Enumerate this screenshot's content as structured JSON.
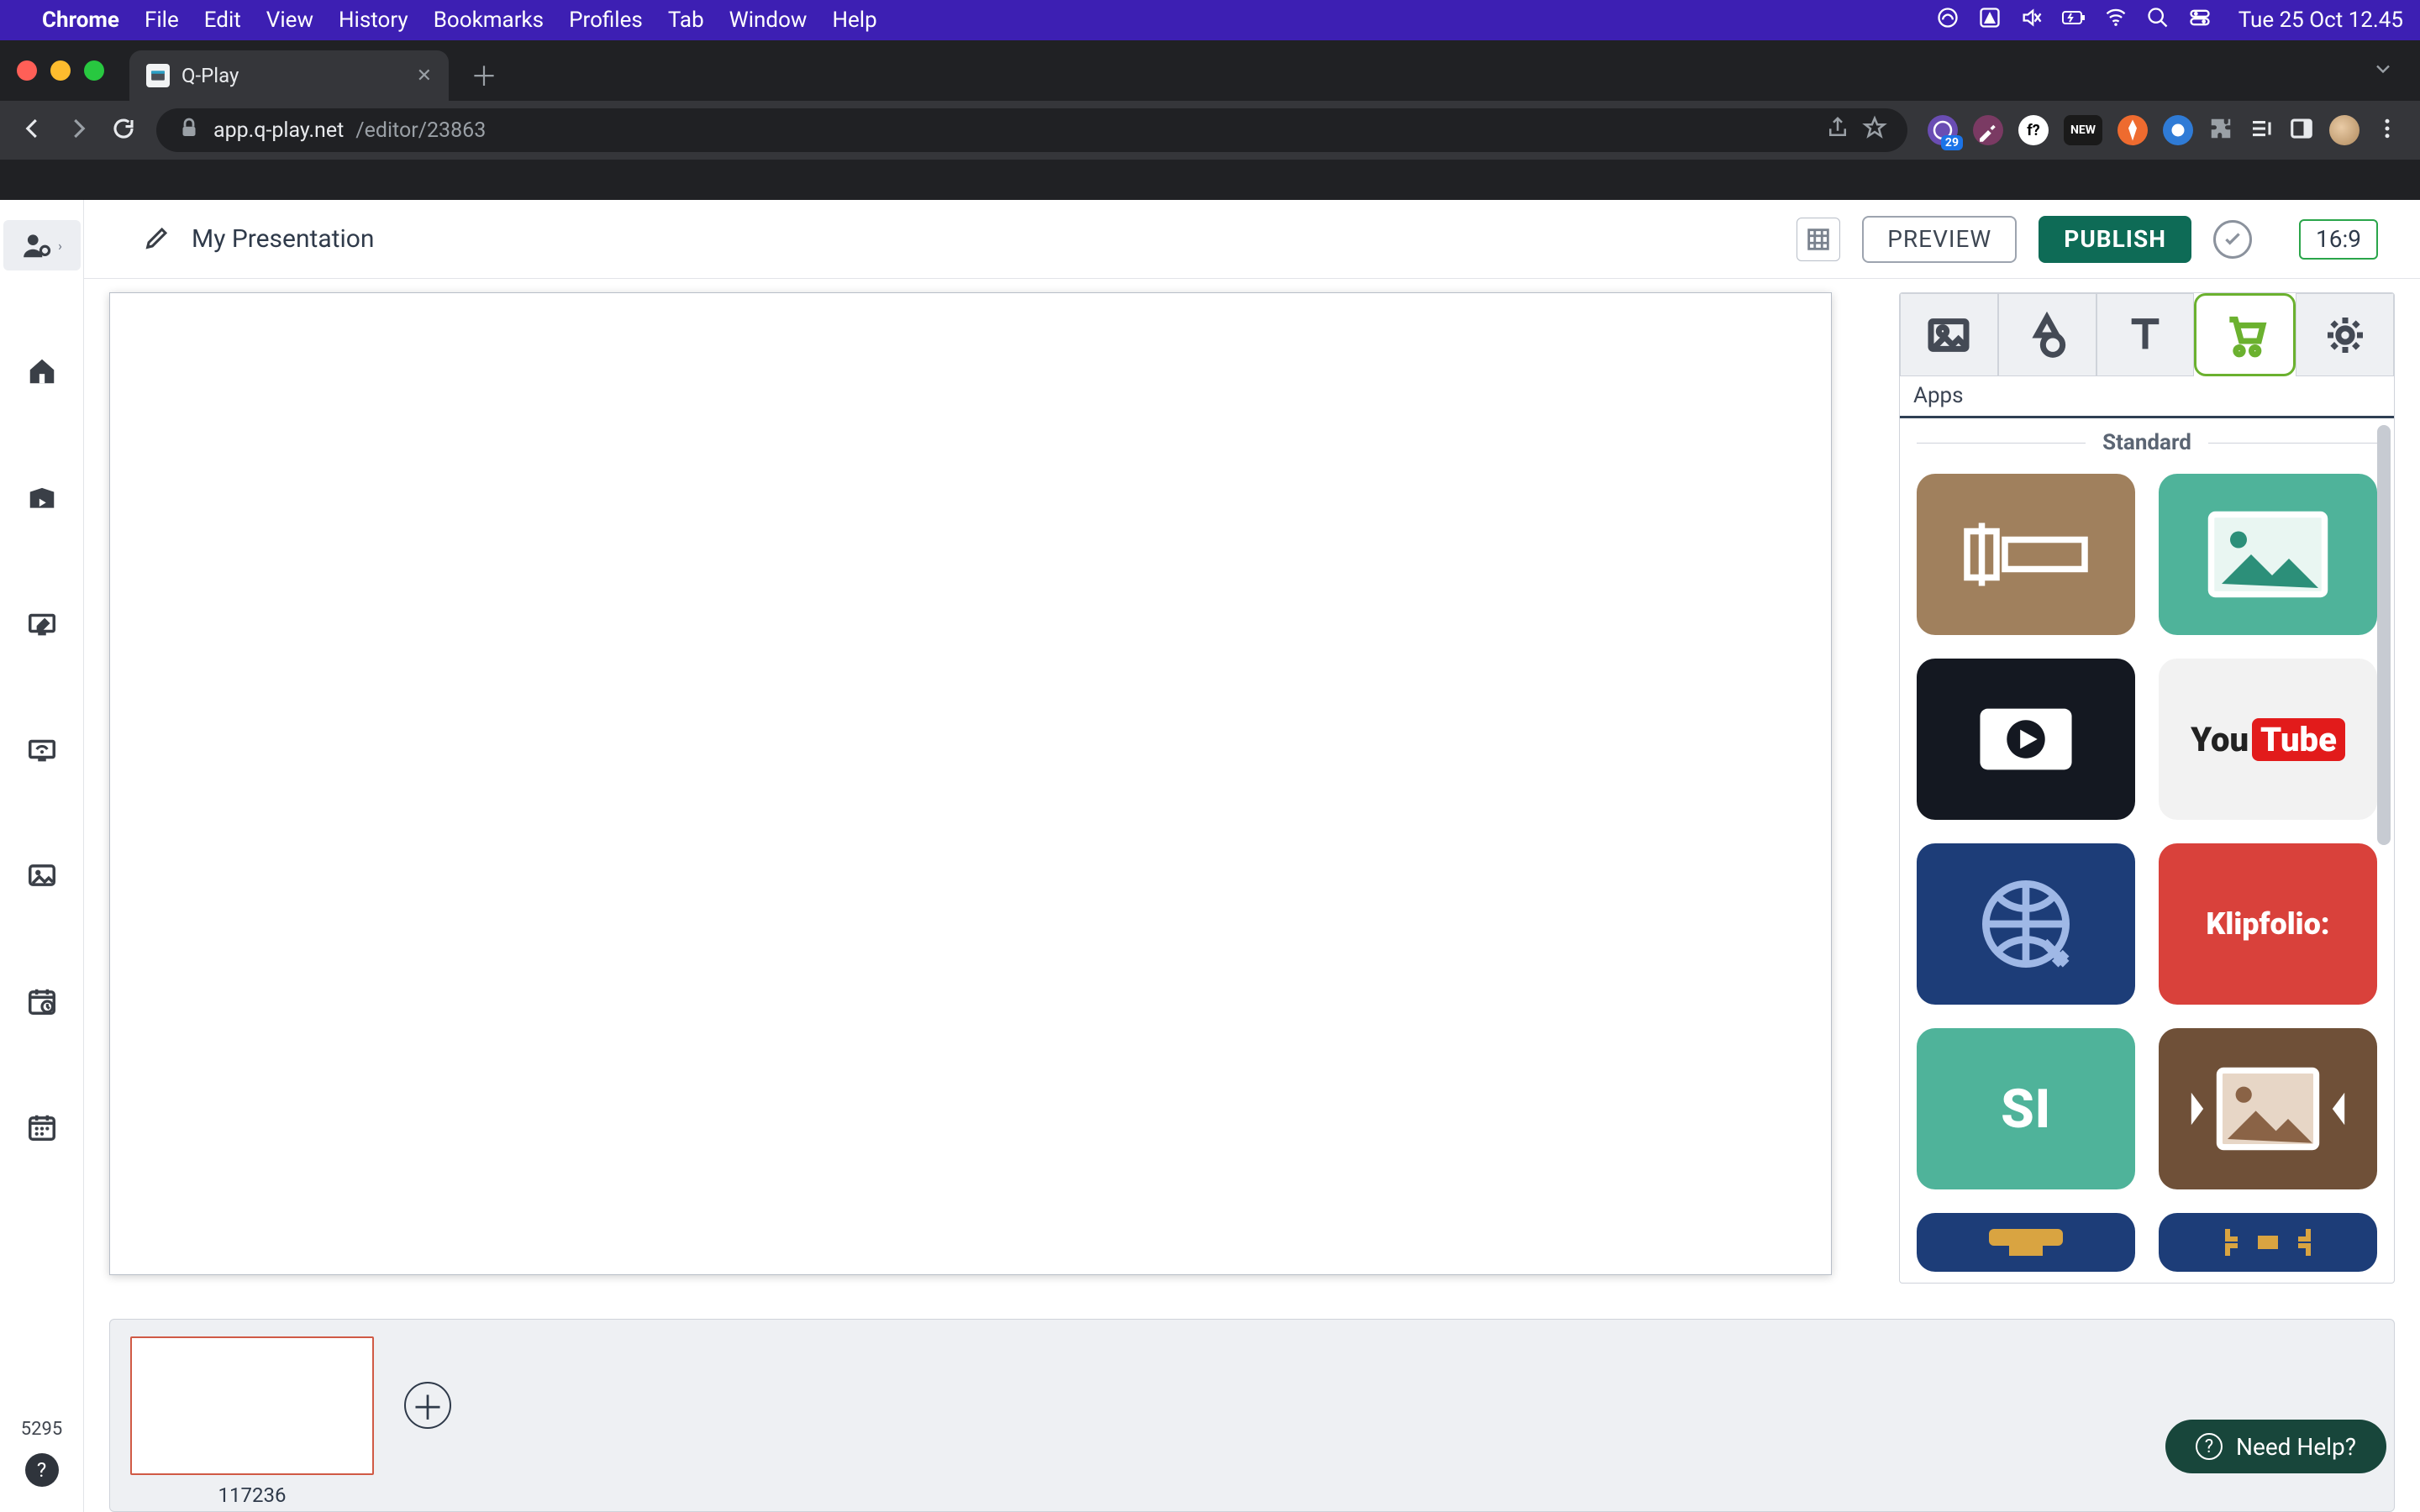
{
  "mac_menu": {
    "app": "Chrome",
    "items": [
      "File",
      "Edit",
      "View",
      "History",
      "Bookmarks",
      "Profiles",
      "Tab",
      "Window",
      "Help"
    ],
    "datetime": "Tue 25 Oct  12.45",
    "ext_new_label": "NEW",
    "ext_badge": "29"
  },
  "browser": {
    "tab_title": "Q-Play",
    "url_host": "app.q-play.net",
    "url_path": "/editor/23863"
  },
  "toolbar": {
    "title": "My Presentation",
    "preview": "PREVIEW",
    "publish": "PUBLISH",
    "ratio": "16:9"
  },
  "left_rail": {
    "bottom_number": "5295"
  },
  "right_panel": {
    "subhead": "Apps",
    "section": "Standard",
    "tiles": [
      {
        "name": "text-app",
        "variant": "brown"
      },
      {
        "name": "image-app",
        "variant": "teal"
      },
      {
        "name": "video-app",
        "variant": "dark"
      },
      {
        "name": "youtube-app",
        "variant": "light"
      },
      {
        "name": "web-app",
        "variant": "navy"
      },
      {
        "name": "klipfolio-app",
        "variant": "red",
        "label": "Klipfolio:"
      },
      {
        "name": "si-app",
        "variant": "teal2",
        "label": "SI"
      },
      {
        "name": "slideshow-app",
        "variant": "brown2"
      },
      {
        "name": "bar-app",
        "variant": "navybar"
      },
      {
        "name": "qr-app",
        "variant": "navyqr"
      }
    ]
  },
  "filmstrip": {
    "slide_id": "117236"
  },
  "help": {
    "label": "Need Help?"
  },
  "youtube": {
    "you": "You",
    "tube": "Tube"
  }
}
